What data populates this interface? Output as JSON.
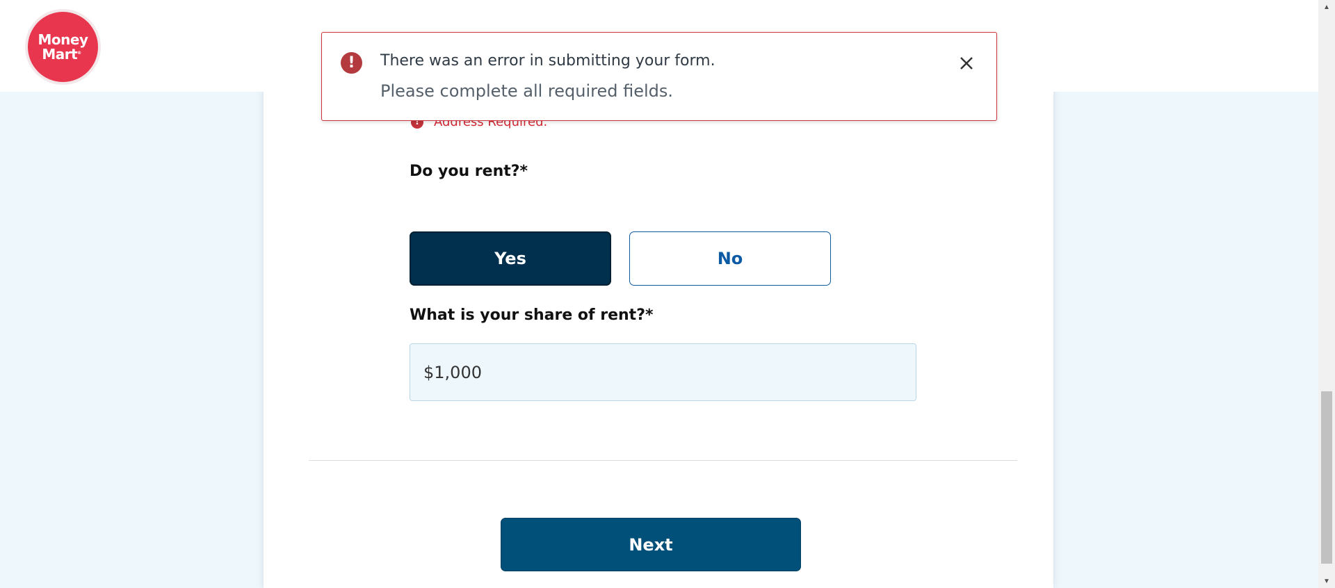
{
  "header": {
    "logo_line1": "Money",
    "logo_line2": "Mart"
  },
  "alert": {
    "title": "There was an error in submitting your form.",
    "message": "Please complete all required fields.",
    "icon": "!"
  },
  "address": {
    "error": "Address Required."
  },
  "rent_question": {
    "label": "Do you rent?*",
    "yes_label": "Yes",
    "no_label": "No",
    "selected": "Yes"
  },
  "share_question": {
    "label": "What is your share of rent?*",
    "value": "$1,000"
  },
  "footer": {
    "next_label": "Next"
  },
  "colors": {
    "brand_red": "#e8364e",
    "selected_navy": "#00304e",
    "next_blue": "#00507a",
    "error_red": "#d22b36"
  }
}
